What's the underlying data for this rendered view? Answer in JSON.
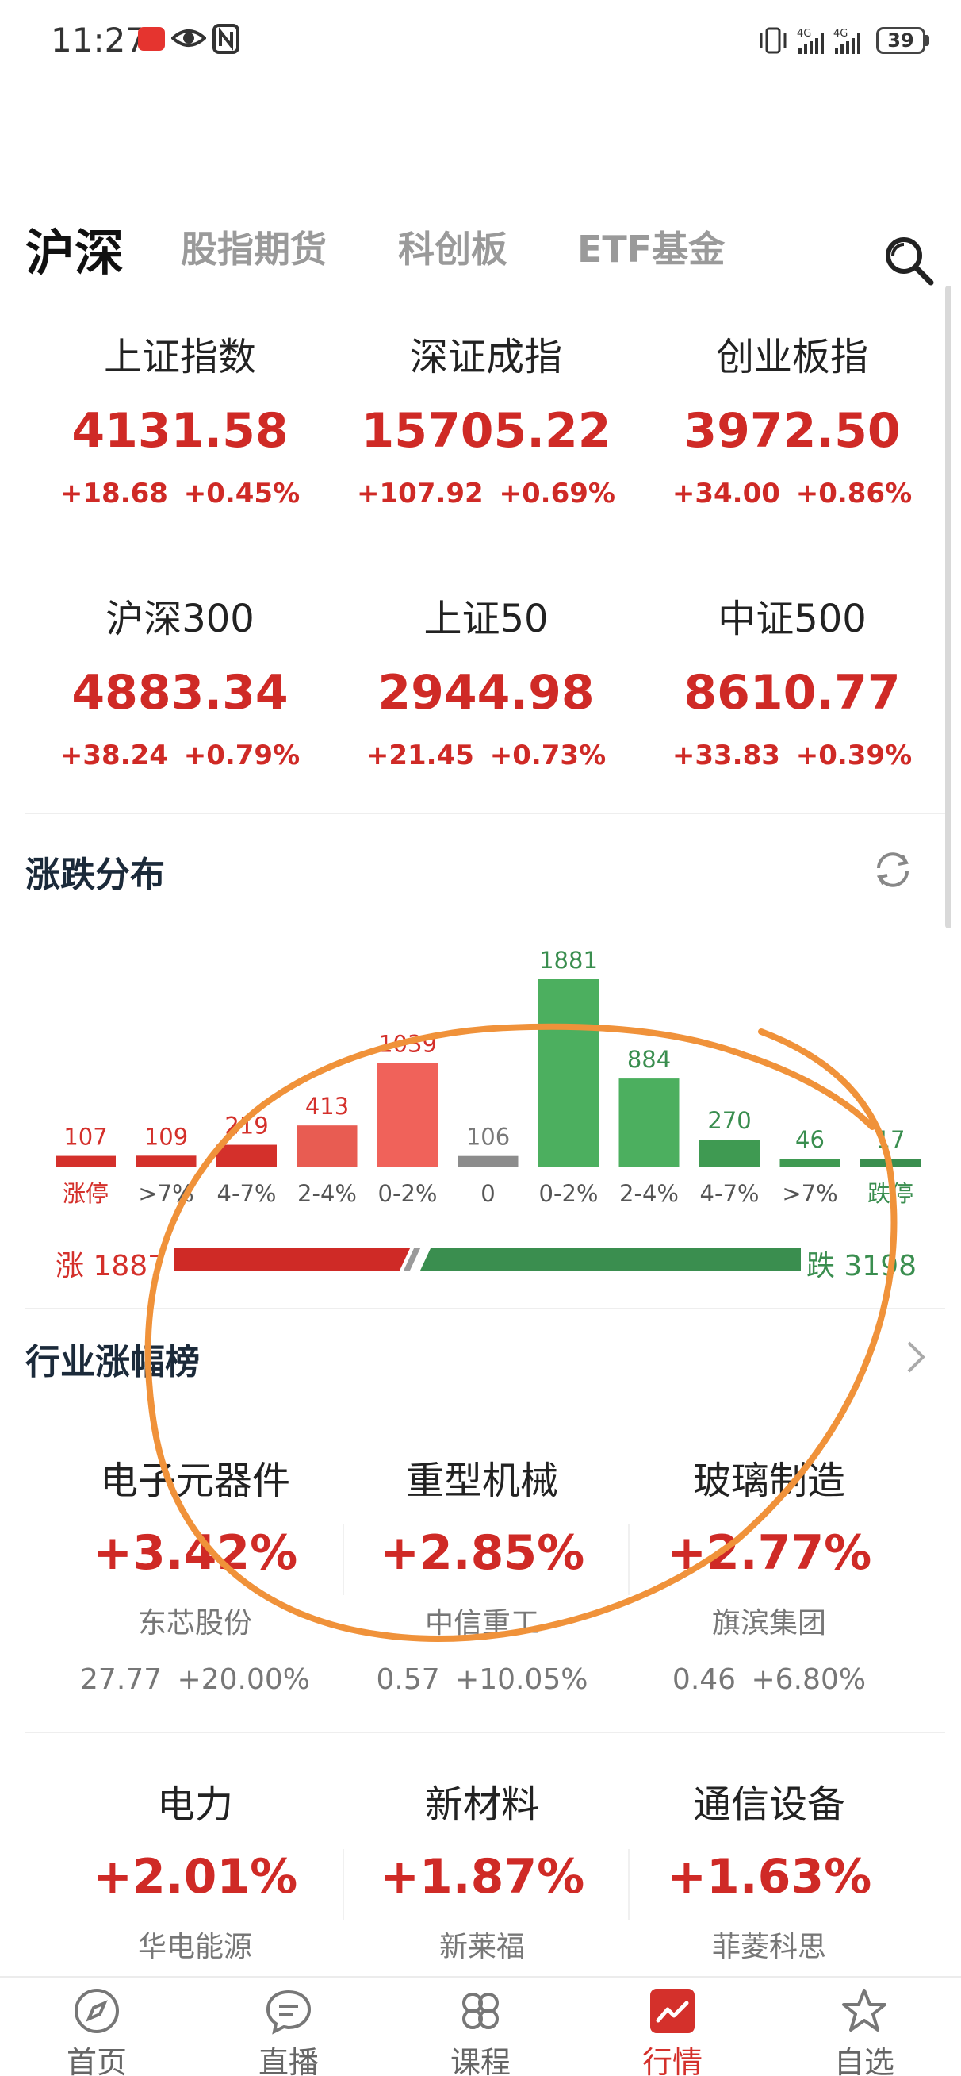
{
  "status_bar": {
    "time": "11:27",
    "battery": "39",
    "net_label_1": "4G",
    "net_label_2": "4G"
  },
  "tabs": [
    {
      "label": "沪深",
      "active": true
    },
    {
      "label": "股指期货",
      "active": false
    },
    {
      "label": "科创板",
      "active": false
    },
    {
      "label": "ETF基金",
      "active": false
    }
  ],
  "indices": [
    {
      "name": "上证指数",
      "value": "4131.58",
      "change": "+18.68 +0.45%"
    },
    {
      "name": "深证成指",
      "value": "15705.22",
      "change": "+107.92 +0.69%"
    },
    {
      "name": "创业板指",
      "value": "3972.50",
      "change": "+34.00 +0.86%"
    },
    {
      "name": "沪深300",
      "value": "4883.34",
      "change": "+38.24 +0.79%"
    },
    {
      "name": "上证50",
      "value": "2944.98",
      "change": "+21.45 +0.73%"
    },
    {
      "name": "中证500",
      "value": "8610.77",
      "change": "+33.83 +0.39%"
    }
  ],
  "distribution": {
    "title": "涨跌分布",
    "up_label": "涨 1887",
    "down_label": "跌 3198",
    "up_total": 1887,
    "down_total": 3198
  },
  "chart_data": {
    "type": "bar",
    "categories": [
      "涨停",
      ">7%",
      "4-7%",
      "2-4%",
      "0-2%",
      "0",
      "0-2%",
      "2-4%",
      "4-7%",
      ">7%",
      "跌停"
    ],
    "values": [
      107,
      109,
      219,
      413,
      1039,
      106,
      1881,
      884,
      270,
      46,
      17
    ],
    "value_labels": [
      "107",
      "109",
      "219",
      "413",
      "1039",
      "106",
      "1881",
      "884",
      "270",
      "46",
      "17"
    ],
    "bar_colors": [
      "#d4302b",
      "#d4302b",
      "#d4302b",
      "#e85c52",
      "#f0625a",
      "#8c8c8c",
      "#4caf5f",
      "#4caf5f",
      "#3f9a52",
      "#3f9a52",
      "#3a8e4f"
    ],
    "label_colors": [
      "#d4302b",
      "#d4302b",
      "#d4302b",
      "#d4302b",
      "#d4302b",
      "#777777",
      "#3a8e4f",
      "#3a8e4f",
      "#3a8e4f",
      "#3a8e4f",
      "#3a8e4f"
    ],
    "title": "涨跌分布",
    "ylim": [
      0,
      1881
    ]
  },
  "industry": {
    "title": "行业涨幅榜",
    "items": [
      {
        "name": "电子元器件",
        "pct": "+3.42%",
        "stock": "东芯股份",
        "price": "27.77 +20.00%"
      },
      {
        "name": "重型机械",
        "pct": "+2.85%",
        "stock": "中信重工",
        "price": "0.57 +10.05%"
      },
      {
        "name": "玻璃制造",
        "pct": "+2.77%",
        "stock": "旗滨集团",
        "price": "0.46 +6.80%"
      },
      {
        "name": "电力",
        "pct": "+2.01%",
        "stock": "华电能源",
        "price": ""
      },
      {
        "name": "新材料",
        "pct": "+1.87%",
        "stock": "新莱福",
        "price": ""
      },
      {
        "name": "通信设备",
        "pct": "+1.63%",
        "stock": "菲菱科思",
        "price": ""
      }
    ]
  },
  "nav": [
    {
      "label": "首页",
      "icon": "compass-icon"
    },
    {
      "label": "直播",
      "icon": "chat-bubble-icon"
    },
    {
      "label": "课程",
      "icon": "grid-flower-icon"
    },
    {
      "label": "行情",
      "icon": "market-chart-icon",
      "active": true
    },
    {
      "label": "自选",
      "icon": "star-icon"
    }
  ],
  "colors": {
    "up": "#cf2a26",
    "down": "#3a8e4f",
    "annotation": "#f0923a"
  }
}
